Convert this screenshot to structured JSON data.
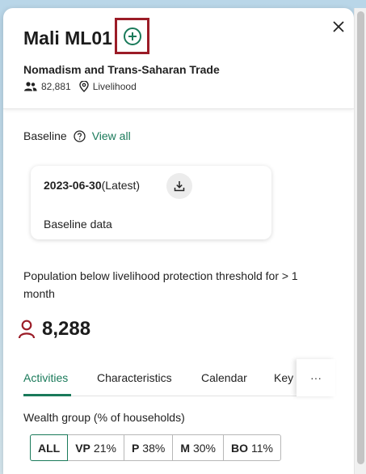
{
  "header": {
    "title": "Mali ML01",
    "subtitle": "Nomadism and Trans-Saharan Trade",
    "population": "82,881",
    "type_label": "Livelihood"
  },
  "baseline": {
    "label": "Baseline",
    "view_all": "View all",
    "card": {
      "date": "2023-06-30",
      "tag": "(Latest)",
      "data_label": "Baseline data"
    }
  },
  "population_threshold": {
    "description": "Population below livelihood protection threshold for > 1 month",
    "value": "8,288"
  },
  "tabs": {
    "items": [
      "Activities",
      "Characteristics",
      "Calendar",
      "Key"
    ],
    "active": "Activities",
    "overflow": "···"
  },
  "wealth": {
    "label": "Wealth group (% of households)",
    "groups": [
      {
        "code": "ALL",
        "value": ""
      },
      {
        "code": "VP",
        "value": "21%"
      },
      {
        "code": "P",
        "value": "38%"
      },
      {
        "code": "M",
        "value": "30%"
      },
      {
        "code": "BO",
        "value": "11%"
      }
    ]
  },
  "icons": {
    "add": "plus-circle-icon",
    "close": "close-icon",
    "people": "people-icon",
    "location": "location-pin-icon",
    "help": "help-circle-icon",
    "download": "download-icon",
    "person": "person-icon"
  },
  "colors": {
    "accent": "#1a7a5a",
    "highlight": "#9b1c27",
    "person_icon": "#9b1c27"
  }
}
